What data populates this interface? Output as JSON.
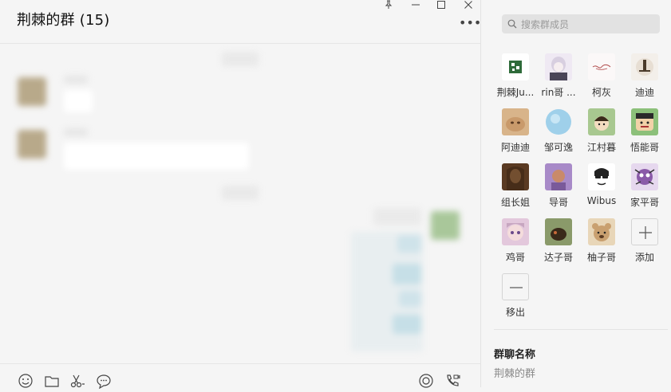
{
  "chat": {
    "title": "荆棘的群 (15)"
  },
  "members_panel": {
    "search_placeholder": "搜索群成员",
    "members": [
      {
        "name": "荆棘Ju...",
        "avatar_color": "#2f6b3a"
      },
      {
        "name": "rin哥 ...",
        "avatar_color": "#b9a7c7"
      },
      {
        "name": "柯灰",
        "avatar_color": "#f0eaea"
      },
      {
        "name": "迪迪",
        "avatar_color": "#d9cfc3"
      },
      {
        "name": "阿迪迪",
        "avatar_color": "#c79a6b"
      },
      {
        "name": "邹可逸",
        "avatar_color": "#9fd0ea"
      },
      {
        "name": "江村暮",
        "avatar_color": "#7fa06a"
      },
      {
        "name": "悟能哥",
        "avatar_color": "#6b4a33"
      },
      {
        "name": "组长姐",
        "avatar_color": "#7a4a2a"
      },
      {
        "name": "导哥",
        "avatar_color": "#9c7ab8"
      },
      {
        "name": "Wibus",
        "avatar_color": "#ffffff"
      },
      {
        "name": "家平哥",
        "avatar_color": "#8a5aa8"
      },
      {
        "name": "鸡哥",
        "avatar_color": "#c7a6c0"
      },
      {
        "name": "达子哥",
        "avatar_color": "#7a5a3a"
      },
      {
        "name": "柚子哥",
        "avatar_color": "#c9a070"
      }
    ],
    "add_label": "添加",
    "remove_label": "移出",
    "group_name_label": "群聊名称",
    "group_name_value": "荆棘的群"
  }
}
